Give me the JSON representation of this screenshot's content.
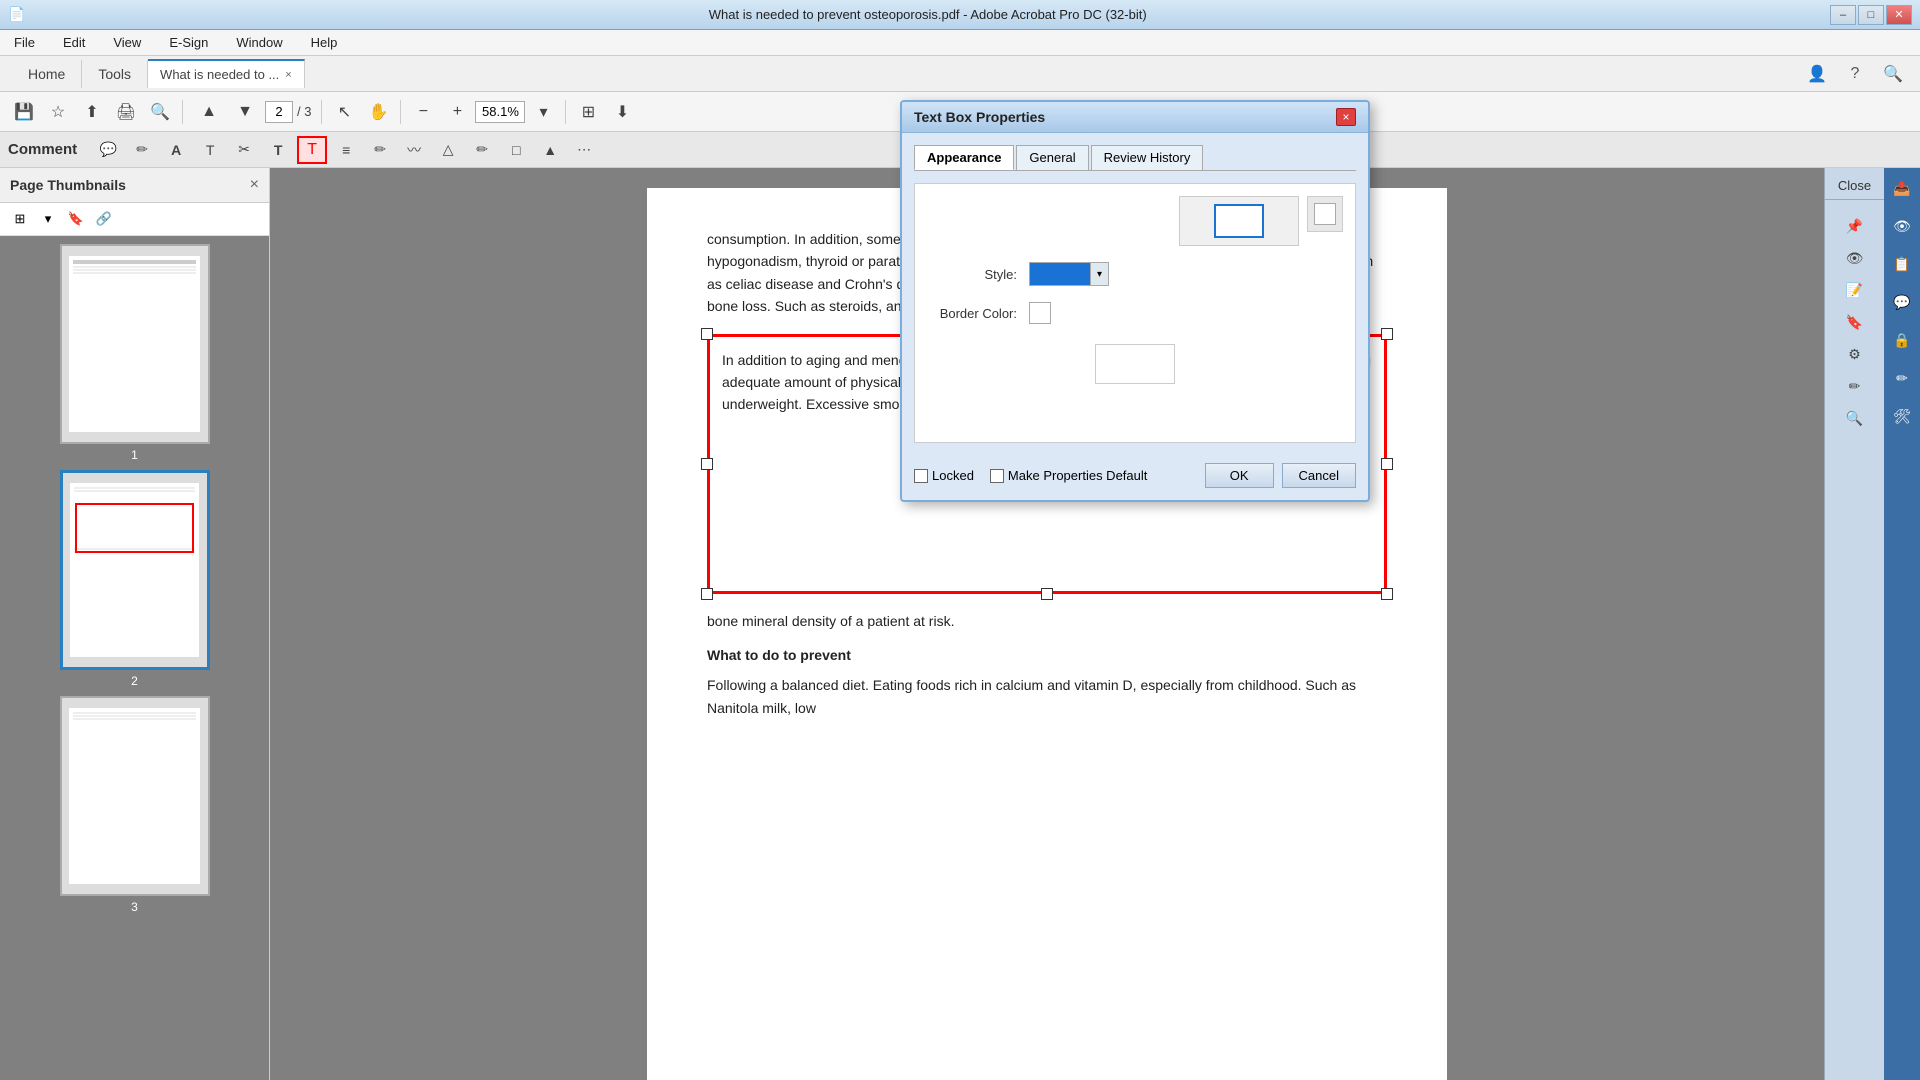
{
  "window": {
    "title": "What is needed to prevent osteoporosis.pdf - Adobe Acrobat Pro DC (32-bit)",
    "min_label": "–",
    "max_label": "□",
    "close_label": "✕"
  },
  "menu": {
    "items": [
      "File",
      "Edit",
      "View",
      "E-Sign",
      "Window",
      "Help"
    ]
  },
  "nav": {
    "home": "Home",
    "tools": "Tools",
    "tab_label": "What is needed to ...",
    "close_tab": "×"
  },
  "toolbar": {
    "save_icon": "💾",
    "bookmark_icon": "☆",
    "upload_icon": "⬆",
    "print_icon": "🖨",
    "search_icon": "🔍",
    "page_prev": "⬆",
    "page_next": "⬇",
    "page_current": "2",
    "page_total": "/ 3",
    "cursor_icon": "↖",
    "hand_icon": "✋",
    "zoom_out": "−",
    "zoom_in": "+",
    "zoom_value": "58.1%",
    "fit_icon": "⊞",
    "scroll_icon": "⬇"
  },
  "comment_bar": {
    "label": "Comment",
    "tools": [
      "💬",
      "✏",
      "A",
      "T",
      "✂",
      "T",
      "T",
      "≡",
      "✏",
      "〰",
      "△",
      "✏",
      "□",
      "▲",
      "⋯"
    ]
  },
  "panel": {
    "title": "Page Thumbnails",
    "close": "×",
    "pages": [
      "1",
      "2",
      "3"
    ]
  },
  "pdf": {
    "content_before_box": "consumption. In addition, some diseases increase the risk of osteoporosis. Such as rheumatism, hypogonadism, thyroid or parathyroid hormone problems; Diseases that interfere with food absorption, such as celiac disease and Crohn's disease. If someone is bedridden in the long run. Some drugs also increase bone loss. Such as steroids, anticonvulsants, drugs used to treat cancer.",
    "box_text": "In addition to aging and menopause, there are other causes and risks of osteoporosis. Such as not doing adequate amount of physical exertion. Not getting enough calcium and vitamin D. Malnutrition and underweight. Excessive smoking or alcohol consumption.",
    "content_after_box": "bone mineral density of a patient at risk.",
    "what_to_do": "What to do to prevent",
    "content_bottom": "Following a balanced diet. Eating foods rich in calcium and vitamin D, especially from childhood. Such as Nanitola milk, low"
  },
  "right_panel": {
    "close_label": "Close"
  },
  "dialog": {
    "title": "Text Box Properties",
    "close": "×",
    "tabs": [
      "Appearance",
      "General",
      "Review History"
    ],
    "active_tab": "Appearance",
    "style_label": "Style:",
    "border_color_label": "Border Color:",
    "preview_label": "",
    "locked_label": "Locked",
    "make_default_label": "Make Properties Default",
    "ok_label": "OK",
    "cancel_label": "Cancel"
  }
}
